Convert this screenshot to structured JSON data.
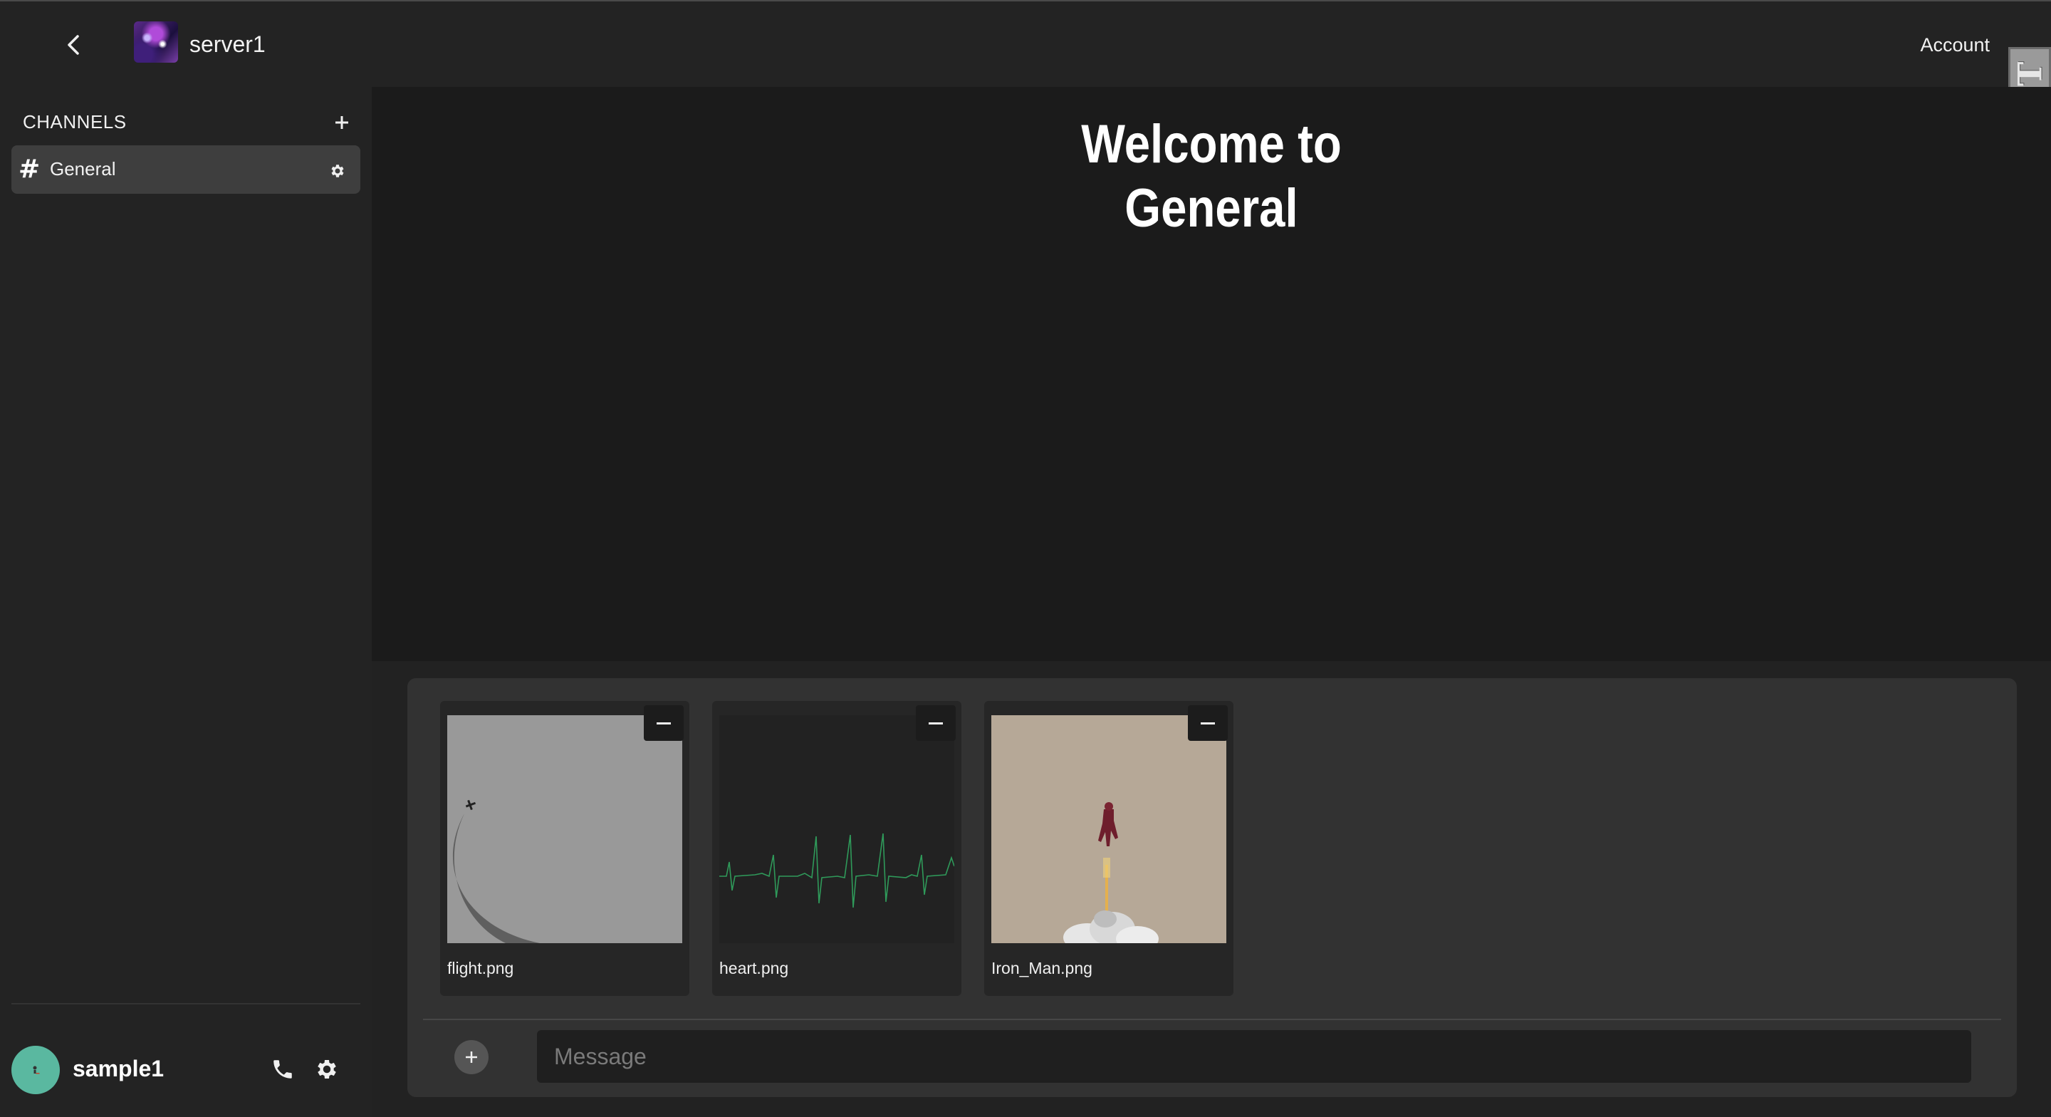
{
  "header": {
    "server_name": "server1",
    "account_label": "Account",
    "badge_text": "FDT"
  },
  "sidebar": {
    "channels_title": "CHANNELS",
    "channels": [
      {
        "label": "General",
        "active": true
      }
    ],
    "user": {
      "name": "sample1",
      "avatar_color": "#5ab8a0"
    }
  },
  "main": {
    "welcome_line1": "Welcome to",
    "welcome_line2": "General"
  },
  "composer": {
    "attachments": [
      {
        "filename": "flight.png"
      },
      {
        "filename": "heart.png"
      },
      {
        "filename": "Iron_Man.png"
      }
    ],
    "message_placeholder": "Message"
  },
  "icons": {
    "back": "chevron-left-icon",
    "add_channel": "plus-icon",
    "channel": "hash-icon",
    "channel_settings": "gear-icon",
    "call": "phone-icon",
    "user_settings": "gear-icon",
    "remove_attachment": "minus-icon",
    "attach": "plus-circle-icon"
  },
  "colors": {
    "background": "#1b1b1b",
    "sidebar": "#232323",
    "active_channel": "#3e3e3e",
    "composer": "#323232",
    "accent_avatar": "#5ab8a0"
  }
}
